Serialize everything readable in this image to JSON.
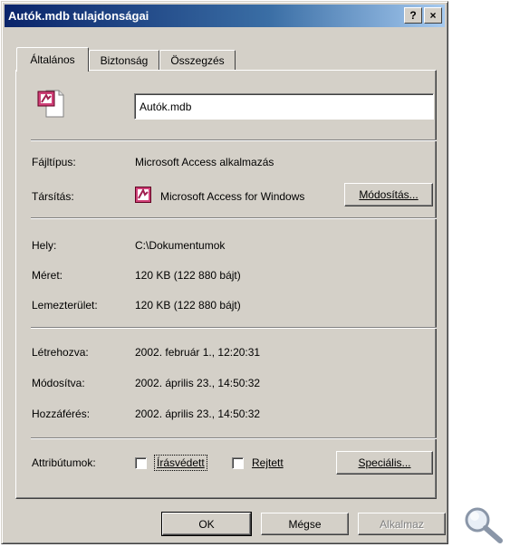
{
  "window": {
    "title": "Autók.mdb tulajdonságai",
    "help_button": "?",
    "close_button": "×"
  },
  "tabs": [
    {
      "label": "Általános",
      "active": true
    },
    {
      "label": "Biztonság",
      "active": false
    },
    {
      "label": "Összegzés",
      "active": false
    }
  ],
  "file": {
    "icon": "access-file-icon",
    "name_value": "Autók.mdb"
  },
  "type_row": {
    "label": "Fájltípus:",
    "value": "Microsoft Access alkalmazás"
  },
  "assoc_row": {
    "label": "Társítás:",
    "icon": "access-app-icon",
    "value": "Microsoft Access for Windows",
    "button": "Módosítás..."
  },
  "location_rows": [
    {
      "label": "Hely:",
      "value": "C:\\Dokumentumok"
    },
    {
      "label": "Méret:",
      "value": "120 KB (122 880 bájt)"
    },
    {
      "label": "Lemezterület:",
      "value": "120 KB (122 880 bájt)"
    }
  ],
  "date_rows": [
    {
      "label": "Létrehozva:",
      "value": "2002. február 1., 12:20:31"
    },
    {
      "label": "Módosítva:",
      "value": "2002. április 23., 14:50:32"
    },
    {
      "label": "Hozzáférés:",
      "value": "2002. április 23., 14:50:32"
    }
  ],
  "attributes": {
    "label": "Attribútumok:",
    "readonly": {
      "label": "Írásvédett",
      "checked": false
    },
    "hidden": {
      "label": "Rejtett",
      "checked": false
    },
    "special_button": "Speciális..."
  },
  "footer": {
    "ok": "OK",
    "cancel": "Mégse",
    "apply": "Alkalmaz"
  },
  "zoom_icon": "magnifier-icon",
  "colors": {
    "title_gradient_start": "#0a246a",
    "title_gradient_end": "#a6caf0",
    "face": "#d4d0c8",
    "access_icon": "#c0306a"
  }
}
